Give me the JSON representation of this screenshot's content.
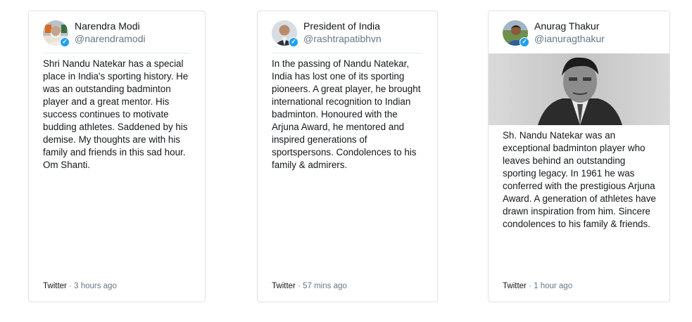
{
  "tweets": [
    {
      "name": "Narendra Modi",
      "handle": "@narendramodi",
      "text": "Shri Nandu Natekar has a special place in India's sporting history. He was an outstanding badminton player and a great mentor. His success continues to motivate budding athletes. Saddened by his demise. My thoughts are with his family and friends in this sad hour. Om Shanti.",
      "source": "Twitter",
      "separator": " · ",
      "time": "3 hours ago"
    },
    {
      "name": "President of India",
      "handle": "@rashtrapatibhvn",
      "text": "In the passing of Nandu Natekar, India has lost one of its sporting pioneers. A great player, he brought international recognition to Indian badminton. Honoured with the Arjuna Award, he mentored and inspired generations of sportspersons. Condolences to his family & admirers.",
      "source": "Twitter",
      "separator": " · ",
      "time": "57 mins ago"
    },
    {
      "name": "Anurag Thakur",
      "handle": "@ianuragthakur",
      "text": "Sh. Nandu Natekar was an exceptional badminton player who leaves behind an outstanding sporting legacy. In 1961 he was conferred with the prestigious Arjuna Award. A generation of athletes have drawn inspiration from him. Sincere condolences to his family & friends.",
      "source": "Twitter",
      "separator": " · ",
      "time": "1 hour ago"
    }
  ],
  "icons": {
    "verified": "verified-badge-icon"
  },
  "colors": {
    "verified": "#1da1f2",
    "muted": "#657786",
    "border": "#dfe3e8",
    "text": "#14171a"
  }
}
